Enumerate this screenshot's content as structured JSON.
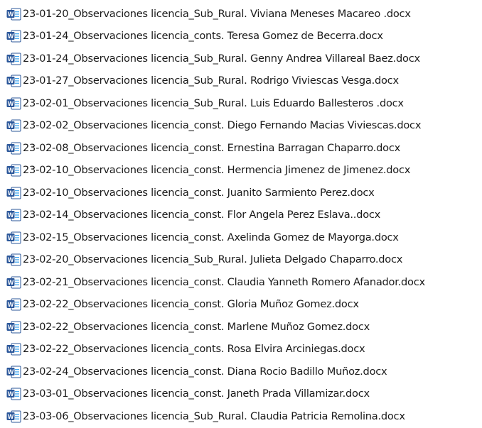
{
  "file_icon": {
    "name": "word-document-icon",
    "letter": "W",
    "color_primary": "#2b579a",
    "color_light": "#41a5ee"
  },
  "files": [
    {
      "name": "23-01-20_Observaciones licencia_Sub_Rural. Viviana Meneses Macareo .docx"
    },
    {
      "name": "23-01-24_Observaciones licencia_conts. Teresa Gomez de Becerra.docx"
    },
    {
      "name": "23-01-24_Observaciones licencia_Sub_Rural. Genny Andrea Villareal Baez.docx"
    },
    {
      "name": "23-01-27_Observaciones licencia_Sub_Rural. Rodrigo Viviescas Vesga.docx"
    },
    {
      "name": "23-02-01_Observaciones licencia_Sub_Rural. Luis Eduardo Ballesteros .docx"
    },
    {
      "name": "23-02-02_Observaciones licencia_const. Diego Fernando Macias Viviescas.docx"
    },
    {
      "name": "23-02-08_Observaciones licencia_const. Ernestina Barragan Chaparro.docx"
    },
    {
      "name": "23-02-10_Observaciones licencia_const. Hermencia Jimenez de Jimenez.docx"
    },
    {
      "name": "23-02-10_Observaciones licencia_const. Juanito Sarmiento Perez.docx"
    },
    {
      "name": "23-02-14_Observaciones licencia_const. Flor Angela Perez Eslava..docx"
    },
    {
      "name": "23-02-15_Observaciones licencia_const. Axelinda Gomez de Mayorga.docx"
    },
    {
      "name": "23-02-20_Observaciones licencia_Sub_Rural. Julieta Delgado Chaparro.docx"
    },
    {
      "name": "23-02-21_Observaciones licencia_const. Claudia Yanneth Romero Afanador.docx"
    },
    {
      "name": "23-02-22_Observaciones licencia_const. Gloria Muñoz Gomez.docx"
    },
    {
      "name": "23-02-22_Observaciones licencia_const. Marlene Muñoz Gomez.docx"
    },
    {
      "name": "23-02-22_Observaciones licencia_conts. Rosa Elvira Arciniegas.docx"
    },
    {
      "name": "23-02-24_Observaciones licencia_const. Diana Rocio Badillo Muñoz.docx"
    },
    {
      "name": "23-03-01_Observaciones licencia_const. Janeth Prada Villamizar.docx"
    },
    {
      "name": "23-03-06_Observaciones licencia_Sub_Rural. Claudia Patricia Remolina.docx"
    }
  ]
}
